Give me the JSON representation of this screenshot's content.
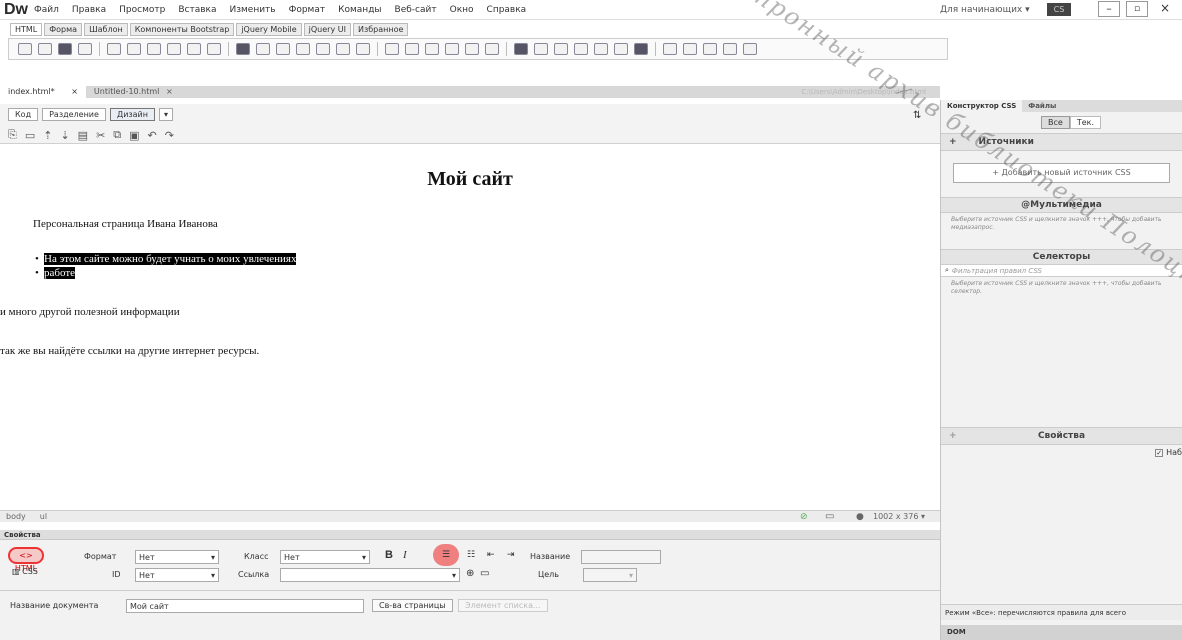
{
  "app": {
    "logo": "Dw",
    "workspace": "Для начинающих",
    "cs_label": "CS"
  },
  "menu": [
    "Файл",
    "Правка",
    "Просмотр",
    "Вставка",
    "Изменить",
    "Формат",
    "Команды",
    "Веб-сайт",
    "Окно",
    "Справка"
  ],
  "insert_tabs": [
    "HTML",
    "Форма",
    "Шаблон",
    "Компоненты Bootstrap",
    "jQuery Mobile",
    "jQuery UI",
    "Избранное"
  ],
  "doc_tabs": [
    {
      "label": "index.html*",
      "close": "×"
    },
    {
      "label": "Untitled-10.html",
      "close": "×"
    }
  ],
  "doc_path": "C:\\Users\\Admin\\Desktop\\index.html",
  "view_buttons": {
    "code": "Код",
    "split": "Разделение",
    "design": "Дизайн"
  },
  "page": {
    "heading": "Мой сайт",
    "paragraph": "Персональная страница Ивана Иванова",
    "list": [
      "На этом сайте можно будет учнать о моих увлечениях",
      "работе"
    ],
    "line1": "и много другой полезной информации",
    "line2": "так же вы найдёте ссылки на другие интернет ресурсы."
  },
  "status": {
    "tag1": "body",
    "tag2": "ul",
    "size": "1002 x 376"
  },
  "properties": {
    "title": "Свойства",
    "html_btn": "HTML",
    "css_btn": "CSS",
    "format_label": "Формат",
    "format_value": "Нет",
    "class_label": "Класс",
    "class_value": "Нет",
    "id_label": "ID",
    "id_value": "Нет",
    "link_label": "Ссылка",
    "name_label": "Название",
    "target_label": "Цель",
    "bold": "B",
    "italic": "I",
    "doc_title_label": "Название документа",
    "doc_title_value": "Мой сайт",
    "page_props_btn": "Св-ва страницы",
    "list_item_btn": "Элемент списка..."
  },
  "css_panel": {
    "tabs": [
      "Конструктор CSS",
      "Файлы"
    ],
    "all": "Все",
    "current": "Тек.",
    "sources": "Источники",
    "add_source": "+ Добавить новый источник CSS",
    "media": "@Мультимедиа",
    "media_hint": "Выберите источник CSS и щелкните значок +++, чтобы добавить медиазапрос.",
    "selectors": "Селекторы",
    "filter_placeholder": "Фильтрация правил CSS",
    "selectors_hint": "Выберите источник CSS и щелкните значок +++, чтобы добавить селектор.",
    "props": "Свойства",
    "show_set": "Наб",
    "footer_hint": "Режим «Все»: перечисляются правила для всего",
    "dom_tab": "DOM"
  },
  "watermark": "Электронный архив библиотеки Полоцкого государственного университета"
}
